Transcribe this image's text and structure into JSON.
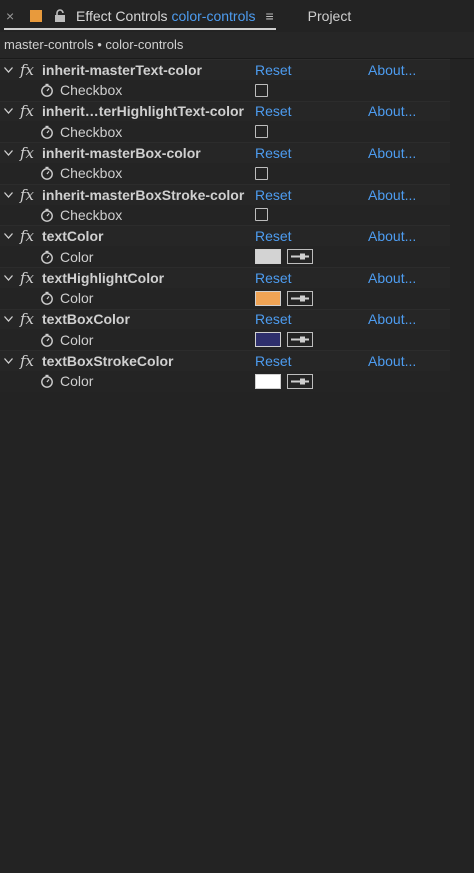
{
  "header": {
    "close_glyph": "×",
    "active_tab_prefix": "Effect Controls",
    "active_tab_comp": "color-controls",
    "menu_glyph": "≡",
    "other_tab": "Project",
    "indicator_color": "#e89a3c"
  },
  "breadcrumb": "master-controls • color-controls",
  "effects": [
    {
      "name": "inherit-masterText-color",
      "reset": "Reset",
      "about": "About...",
      "prop": "Checkbox",
      "type": "checkbox"
    },
    {
      "name": "inherit…terHighlightText-color",
      "reset": "Reset",
      "about": "About...",
      "prop": "Checkbox",
      "type": "checkbox"
    },
    {
      "name": "inherit-masterBox-color",
      "reset": "Reset",
      "about": "About...",
      "prop": "Checkbox",
      "type": "checkbox"
    },
    {
      "name": "inherit-masterBoxStroke-color",
      "reset": "Reset",
      "about": "About...",
      "prop": "Checkbox",
      "type": "checkbox"
    },
    {
      "name": "textColor",
      "reset": "Reset",
      "about": "About...",
      "prop": "Color",
      "type": "color",
      "color": "#d3d3d3"
    },
    {
      "name": "textHighlightColor",
      "reset": "Reset",
      "about": "About...",
      "prop": "Color",
      "type": "color",
      "color": "#f0a455"
    },
    {
      "name": "textBoxColor",
      "reset": "Reset",
      "about": "About...",
      "prop": "Color",
      "type": "color",
      "color": "#2e2f6c"
    },
    {
      "name": "textBoxStrokeColor",
      "reset": "Reset",
      "about": "About...",
      "prop": "Color",
      "type": "color",
      "color": "#ffffff"
    }
  ],
  "icons": {
    "fx": "fx",
    "twirl": "chevron-down-icon",
    "stopwatch": "stopwatch-icon",
    "eyedropper": "eyedropper-icon",
    "lock": "lock-icon"
  }
}
